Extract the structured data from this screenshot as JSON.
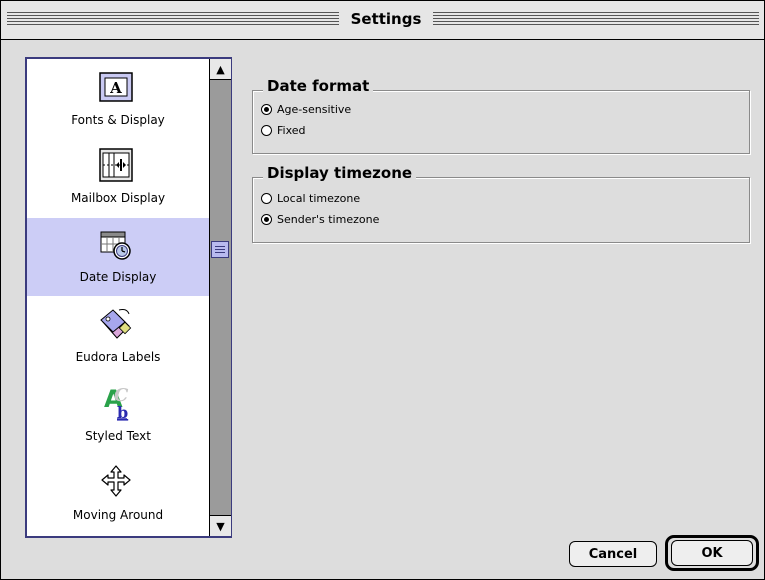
{
  "window": {
    "title": "Settings"
  },
  "sidebar": {
    "items": [
      {
        "label": "Fonts & Display",
        "icon": "fonts-display-icon",
        "selected": false
      },
      {
        "label": "Mailbox Display",
        "icon": "mailbox-display-icon",
        "selected": false
      },
      {
        "label": "Date Display",
        "icon": "date-display-icon",
        "selected": true
      },
      {
        "label": "Eudora Labels",
        "icon": "labels-icon",
        "selected": false
      },
      {
        "label": "Styled Text",
        "icon": "styled-text-icon",
        "selected": false
      },
      {
        "label": "Moving Around",
        "icon": "moving-around-icon",
        "selected": false
      }
    ]
  },
  "date_format": {
    "title": "Date format",
    "options": [
      {
        "label": "Age-sensitive",
        "checked": true
      },
      {
        "label": "Fixed",
        "checked": false
      }
    ]
  },
  "display_timezone": {
    "title": "Display timezone",
    "options": [
      {
        "label": "Local timezone",
        "checked": false
      },
      {
        "label": "Sender's timezone",
        "checked": true
      }
    ]
  },
  "buttons": {
    "cancel": "Cancel",
    "ok": "OK"
  },
  "colors": {
    "selection": "#cccdf6",
    "list_border": "#3b3b7e",
    "window_bg": "#dddddd"
  }
}
